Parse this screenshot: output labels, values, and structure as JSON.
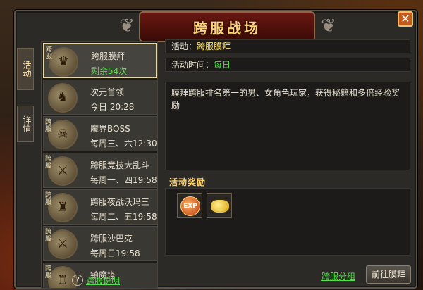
{
  "window": {
    "title": "跨服战场",
    "close_glyph": "✕"
  },
  "side_tabs": [
    {
      "label": "活动",
      "active": true
    },
    {
      "label": "详情",
      "active": false
    }
  ],
  "activity_list": [
    {
      "tag": "跨服",
      "name": "跨服膜拜",
      "time": "剩余54次",
      "time_color": "green",
      "selected": true,
      "icon": "worship-icon"
    },
    {
      "tag": "",
      "name": "次元首领",
      "time": "今日 20:28",
      "time_color": "normal",
      "selected": false,
      "icon": "dragon-boss-icon"
    },
    {
      "tag": "跨服",
      "name": "魔界BOSS",
      "time": "每周三、六12:30",
      "time_color": "normal",
      "selected": false,
      "icon": "demon-boss-icon"
    },
    {
      "tag": "跨服",
      "name": "跨服竞技大乱斗",
      "time": "每周一、四19:58",
      "time_color": "normal",
      "selected": false,
      "icon": "crossed-swords-icon"
    },
    {
      "tag": "跨服",
      "name": "跨服夜战沃玛三",
      "time": "每周二、五19:58",
      "time_color": "normal",
      "selected": false,
      "icon": "woma-warrior-icon"
    },
    {
      "tag": "跨服",
      "name": "跨服沙巴克",
      "time": "每周日19:58",
      "time_color": "normal",
      "selected": false,
      "icon": "crossed-swords-icon"
    },
    {
      "tag": "跨服",
      "name": "镇魔塔",
      "time": "",
      "time_color": "normal",
      "selected": false,
      "icon": "tower-icon"
    }
  ],
  "help": {
    "icon_glyph": "?",
    "label": "跨服说明"
  },
  "detail": {
    "activity_label": "活动：",
    "activity_value": "跨服膜拜",
    "time_label": "活动时间：",
    "time_value": "每日",
    "description": "膜拜跨服排名第一的男、女角色玩家，获得秘籍和多倍经验奖励"
  },
  "rewards": {
    "title": "活动奖励",
    "items": [
      {
        "name": "exp-orb",
        "text": "EXP"
      },
      {
        "name": "gold-ingots",
        "text": ""
      }
    ]
  },
  "footer": {
    "group_link": "跨服分组",
    "go_button": "前往膜拜"
  },
  "colors": {
    "accent_green": "#55e04a",
    "accent_yellow": "#ffe46a",
    "title_gold": "#ffd27a",
    "panel_bg": "#2b2a27"
  }
}
